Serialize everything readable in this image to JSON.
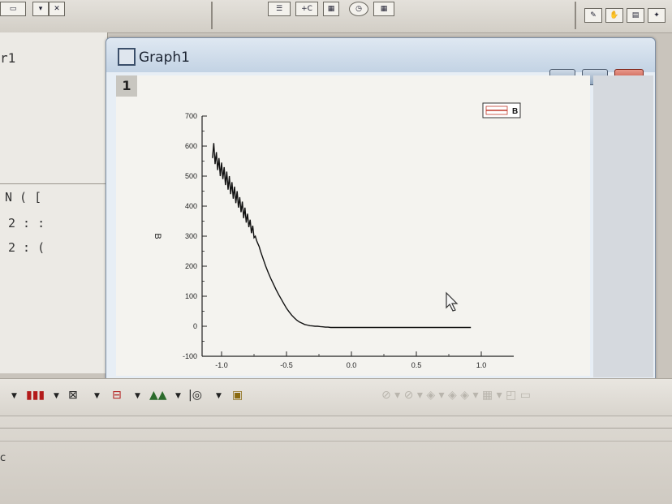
{
  "left_panel": {
    "row_label": "r1",
    "columns_text": "N ( [",
    "row2_text": "2 : :",
    "row3_text": "2 : ("
  },
  "graph_window": {
    "title": "Graph1",
    "layer_number": "1"
  },
  "legend": {
    "label": "B"
  },
  "status_bar": {
    "text": "c"
  },
  "chart_data": {
    "type": "line",
    "title": "",
    "xlabel": "",
    "ylabel": "B",
    "xlim": [
      -1.15,
      1.25
    ],
    "ylim": [
      -100,
      700
    ],
    "x_ticks": [
      "-1.0",
      "-0.5",
      "0.0",
      "0.5",
      "1.0"
    ],
    "y_ticks": [
      "700",
      "600",
      "500",
      "400",
      "300",
      "200",
      "100",
      "0",
      "-100"
    ],
    "grid": false,
    "legend_position": "top-right",
    "series": [
      {
        "name": "B",
        "x": [
          -1.07,
          -1.06,
          -1.05,
          -1.04,
          -1.03,
          -1.02,
          -1.01,
          -1.0,
          -0.99,
          -0.98,
          -0.97,
          -0.96,
          -0.95,
          -0.94,
          -0.93,
          -0.92,
          -0.91,
          -0.9,
          -0.89,
          -0.88,
          -0.87,
          -0.86,
          -0.85,
          -0.84,
          -0.83,
          -0.82,
          -0.81,
          -0.8,
          -0.79,
          -0.78,
          -0.77,
          -0.76,
          -0.75,
          -0.74,
          -0.73,
          -0.72,
          -0.71,
          -0.7,
          -0.68,
          -0.66,
          -0.64,
          -0.62,
          -0.6,
          -0.58,
          -0.56,
          -0.54,
          -0.52,
          -0.5,
          -0.48,
          -0.46,
          -0.44,
          -0.42,
          -0.4,
          -0.38,
          -0.36,
          -0.34,
          -0.32,
          -0.3,
          -0.28,
          -0.26,
          -0.24,
          -0.22,
          -0.2,
          -0.18,
          -0.16,
          -0.1,
          0.0,
          0.2,
          0.4,
          0.6,
          0.8,
          0.92
        ],
        "y": [
          560,
          610,
          540,
          580,
          520,
          560,
          500,
          545,
          490,
          530,
          470,
          515,
          455,
          500,
          440,
          480,
          425,
          465,
          410,
          450,
          395,
          430,
          380,
          415,
          360,
          395,
          345,
          375,
          330,
          355,
          310,
          335,
          295,
          300,
          285,
          275,
          265,
          250,
          225,
          200,
          178,
          158,
          140,
          122,
          105,
          90,
          75,
          60,
          48,
          37,
          28,
          20,
          14,
          10,
          6,
          4,
          2,
          1,
          0,
          0,
          -1,
          -2,
          -3,
          -3,
          -4,
          -4,
          -4,
          -4,
          -4,
          -4,
          -4,
          -4
        ]
      }
    ]
  }
}
